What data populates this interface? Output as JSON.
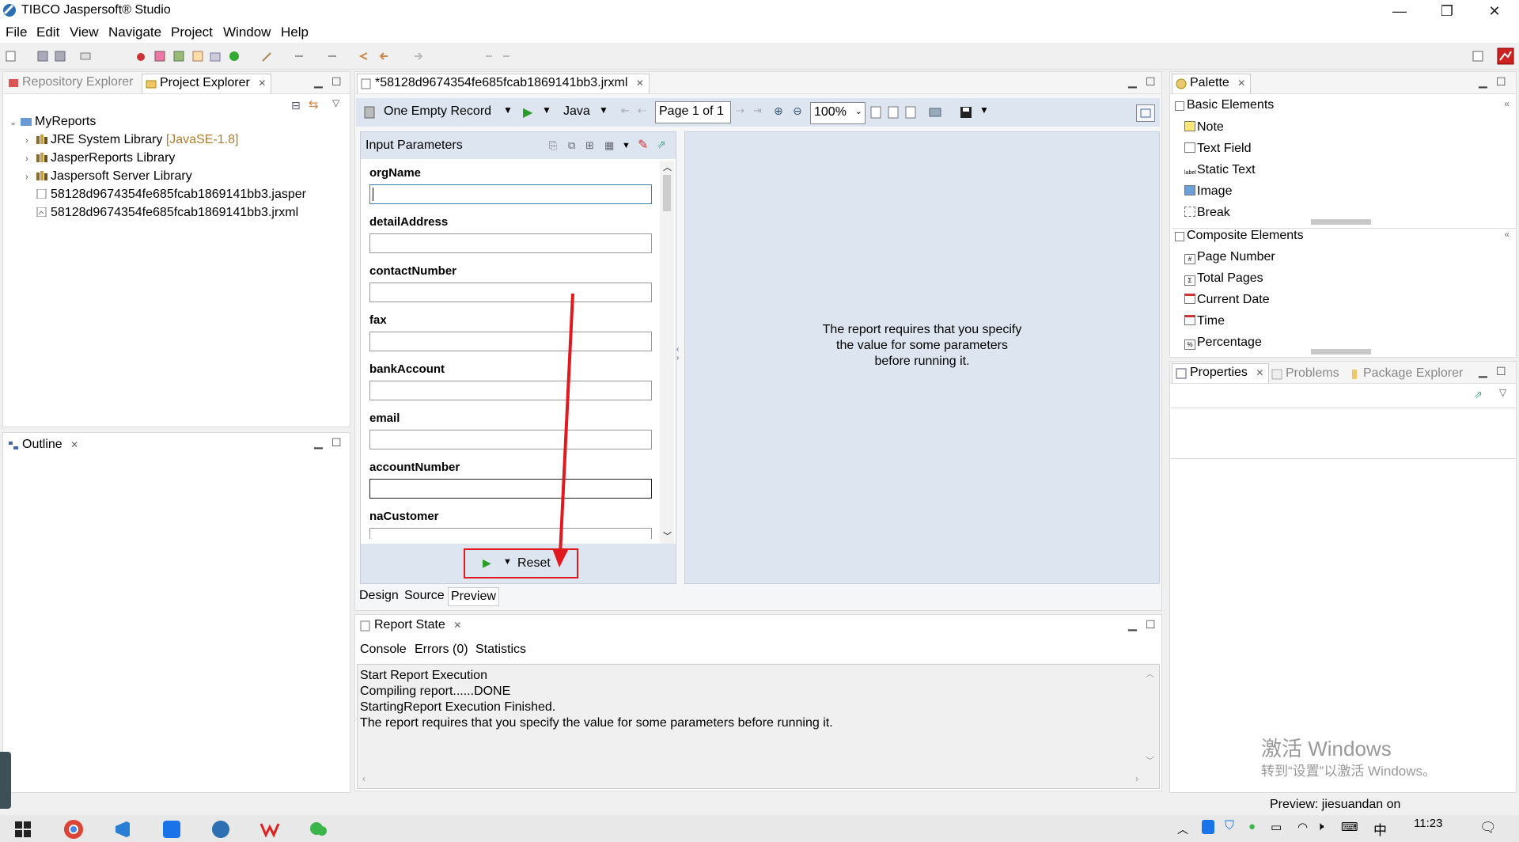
{
  "window": {
    "title": "TIBCO Jaspersoft® Studio",
    "minimize": "—",
    "restore": "❐",
    "close": "✕"
  },
  "menu": [
    "File",
    "Edit",
    "View",
    "Navigate",
    "Project",
    "Window",
    "Help"
  ],
  "left_panel": {
    "tabs": [
      {
        "label": "Repository Explorer",
        "active": false
      },
      {
        "label": "Project Explorer",
        "active": true
      }
    ],
    "tree": [
      {
        "label": "MyReports",
        "level": 0,
        "expanded": true
      },
      {
        "label": "JRE System Library",
        "suffix": "[JavaSE-1.8]",
        "level": 1
      },
      {
        "label": "JasperReports Library",
        "level": 1
      },
      {
        "label": "Jaspersoft Server Library",
        "level": 1
      },
      {
        "label": "58128d9674354fe685fcab1869141bb3.jasper",
        "level": 1
      },
      {
        "label": "58128d9674354fe685fcab1869141bb3.jrxml",
        "level": 1
      }
    ]
  },
  "outline": {
    "label": "Outline"
  },
  "editor": {
    "tab_label": "*58128d9674354fe685fcab1869141bb3.jrxml",
    "data_adapter": "One Empty Record",
    "language": "Java",
    "page_indicator": "Page 1 of 1",
    "zoom": "100%",
    "params_title": "Input Parameters",
    "parameters": [
      {
        "name": "orgName",
        "value": ""
      },
      {
        "name": "detailAddress",
        "value": ""
      },
      {
        "name": "contactNumber",
        "value": ""
      },
      {
        "name": "fax",
        "value": ""
      },
      {
        "name": "bankAccount",
        "value": ""
      },
      {
        "name": "email",
        "value": ""
      },
      {
        "name": "accountNumber",
        "value": ""
      },
      {
        "name": "naCustomer",
        "value": ""
      }
    ],
    "reset_label": "Reset",
    "preview_message": [
      "The report requires that you specify",
      "the value for some parameters",
      "before running it."
    ],
    "bottom_tabs": [
      "Design",
      "Source",
      "Preview"
    ],
    "active_bottom_tab": "Preview"
  },
  "report_state": {
    "title": "Report State",
    "tabs": [
      "Console",
      "Errors (0)",
      "Statistics"
    ],
    "log": [
      "Start Report Execution",
      "Compiling report......DONE",
      "StartingReport Execution Finished.",
      "The report requires that you specify the value for some parameters before running it."
    ]
  },
  "palette": {
    "title": "Palette",
    "groups": [
      {
        "label": "Basic Elements",
        "items": [
          "Note",
          "Text Field",
          "Static Text",
          "Image",
          "Break"
        ]
      },
      {
        "label": "Composite Elements",
        "items": [
          "Page Number",
          "Total Pages",
          "Current Date",
          "Time",
          "Percentage"
        ]
      }
    ]
  },
  "properties": {
    "tabs": [
      {
        "label": "Properties",
        "active": true
      },
      {
        "label": "Problems",
        "active": false
      },
      {
        "label": "Package Explorer",
        "active": false
      }
    ]
  },
  "watermark": {
    "line1": "激活 Windows",
    "line2": "转到“设置”以激活 Windows。"
  },
  "status": {
    "preview": "Preview: jiesuandan on"
  },
  "taskbar": {
    "time": "11:23",
    "ime": "中"
  },
  "colors": {
    "annotation": "#e0191f",
    "accent": "#3c7fb1",
    "panel_blue": "#dde6f0"
  }
}
